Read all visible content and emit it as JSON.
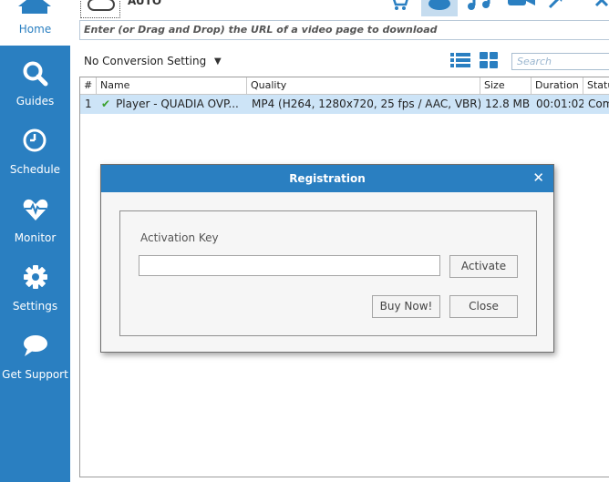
{
  "sidebar": {
    "home": {
      "label": "Home",
      "icon": "home-icon"
    },
    "items": [
      {
        "label": "Guides",
        "icon": "search-icon"
      },
      {
        "label": "Schedule",
        "icon": "clock-icon"
      },
      {
        "label": "Monitor",
        "icon": "heart-pulse-icon"
      },
      {
        "label": "Settings",
        "icon": "gear-icon"
      },
      {
        "label": "Get Support",
        "icon": "chat-bubble-icon"
      }
    ]
  },
  "toolbar": {
    "mode_label": "AUTO"
  },
  "url_bar": {
    "placeholder": "Enter (or Drag and Drop) the URL of a video page to download"
  },
  "options": {
    "conversion": "No Conversion Setting",
    "search_placeholder": "Search"
  },
  "table": {
    "columns": [
      "#",
      "Name",
      "Quality",
      "Size",
      "Duration",
      "Status"
    ],
    "rows": [
      {
        "num": "1",
        "name": "Player  -  QUADIA  OVP...",
        "quality": "MP4 (H264, 1280x720, 25 fps / AAC, VBR)",
        "size": "12.8 MB",
        "duration": "00:01:02",
        "status": "Com"
      }
    ]
  },
  "dialog": {
    "title": "Registration",
    "close_symbol": "✕",
    "activation_label": "Activation Key",
    "activation_value": "",
    "activate_button": "Activate",
    "buy_button": "Buy Now!",
    "close_button": "Close"
  },
  "colors": {
    "accent": "#2a7fc1",
    "selection": "#cde4f7",
    "check": "#3aa02c"
  }
}
